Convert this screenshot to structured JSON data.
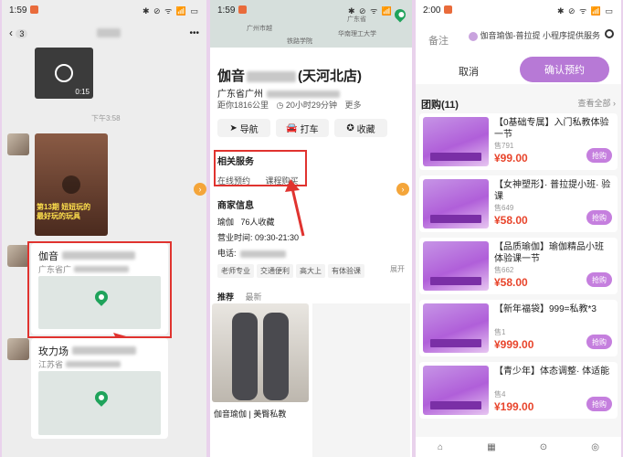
{
  "phone1": {
    "status": {
      "time": "1:59",
      "icons": "✱ ⊘ ᯤ 📶 ▭"
    },
    "chat": {
      "unread": "3",
      "more": "•••"
    },
    "video1": {
      "duration": "0:15"
    },
    "time_divider": "下午3:58",
    "video2": {
      "caption_line1": "第13期 妞妞玩的",
      "caption_line2": "最好玩的玩具"
    },
    "location_card": {
      "name": "伽音",
      "address": "广东省广"
    },
    "location_card2": {
      "name": "玫力场",
      "address": "江苏省"
    }
  },
  "phone2": {
    "status": {
      "time": "1:59",
      "icons": "✱ ⊘ ᯤ 📶 ▭"
    },
    "map_labels": [
      "广州市越",
      "华南理工大学",
      "广东省",
      "铁路学院"
    ],
    "title_prefix": "伽音",
    "title_suffix": "(天河北店)",
    "address": "广东省广州",
    "distance": "距你1816公里",
    "drive_time": "20小时29分钟",
    "more": "更多",
    "actions": {
      "nav": "导航",
      "taxi": "打车",
      "collect": "收藏"
    },
    "related": {
      "title": "相关服务",
      "items": [
        "在线预约",
        "课程购买"
      ]
    },
    "merchant": {
      "title": "商家信息",
      "category": "瑜伽",
      "collect_count": "76人收藏",
      "hours": "营业时间: 09:30-21:30",
      "phone_label": "电话:",
      "tags": [
        "老师专业",
        "交通便利",
        "高大上",
        "有体验课"
      ],
      "expand": "展开"
    },
    "tabs": [
      "推荐",
      "最新"
    ],
    "post_caption": "伽音瑜伽 | 美臀私教"
  },
  "phone3": {
    "status": {
      "time": "2:00",
      "icons": "✱ ⊘ ᯤ 📶 ▭"
    },
    "note_label": "备注",
    "mini_program": "伽音瑜伽-普拉提 小程序提供服务",
    "cancel": "取消",
    "confirm": "确认预约",
    "group_title": "团购(11)",
    "view_all": "查看全部 ›",
    "items": [
      {
        "title": "【0基础专属】入门私教体验一节",
        "sold": "售791",
        "price": "¥99.00",
        "buy": "抢购"
      },
      {
        "title": "【女神塑形】· 普拉提小班· 验课",
        "sold": "售649",
        "price": "¥58.00",
        "buy": "抢购"
      },
      {
        "title": "【品质瑜伽】瑜伽精品小班体验课一节",
        "sold": "售662",
        "price": "¥58.00",
        "buy": "抢购"
      },
      {
        "title": "【新年福袋】999=私教*3",
        "sold": "售1",
        "price": "¥999.00",
        "buy": "抢购"
      },
      {
        "title": "【青少年】体态调整· 体适能",
        "sold": "售4",
        "price": "¥199.00",
        "buy": "抢购"
      }
    ]
  }
}
